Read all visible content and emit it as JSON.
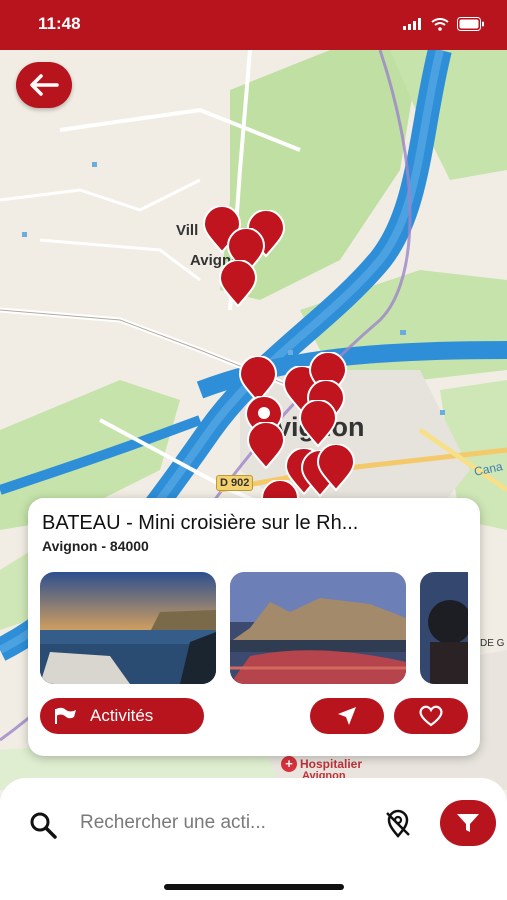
{
  "status_bar": {
    "time": "11:48"
  },
  "map": {
    "labels": {
      "villeneuve_fragment": "Vill",
      "avignon_small": "Avignon",
      "avignon_big": "vignon",
      "road_d902": "D 902",
      "cana_fragment": "Cana",
      "hospital": "Hospitalier",
      "hospital_line2": "Avignon",
      "edge_fragment": "DE G"
    },
    "colors": {
      "river": "#2e8fd8",
      "park": "#b9dc9a",
      "pin": "#c0141f"
    }
  },
  "back_button": {
    "icon": "arrow-left-icon"
  },
  "card": {
    "title": "BATEAU - Mini croisière sur le  Rh...",
    "subtitle": "Avignon - 84000",
    "activities_label": "Activités",
    "activities_icon": "flag-icon",
    "navigate_icon": "navigation-arrow-icon",
    "favorite_icon": "heart-icon"
  },
  "search": {
    "placeholder": "Rechercher une acti...",
    "icon": "search-icon",
    "geo_off_icon": "location-off-icon",
    "filter_icon": "filter-funnel-icon"
  },
  "accent_color": "#b8141e"
}
